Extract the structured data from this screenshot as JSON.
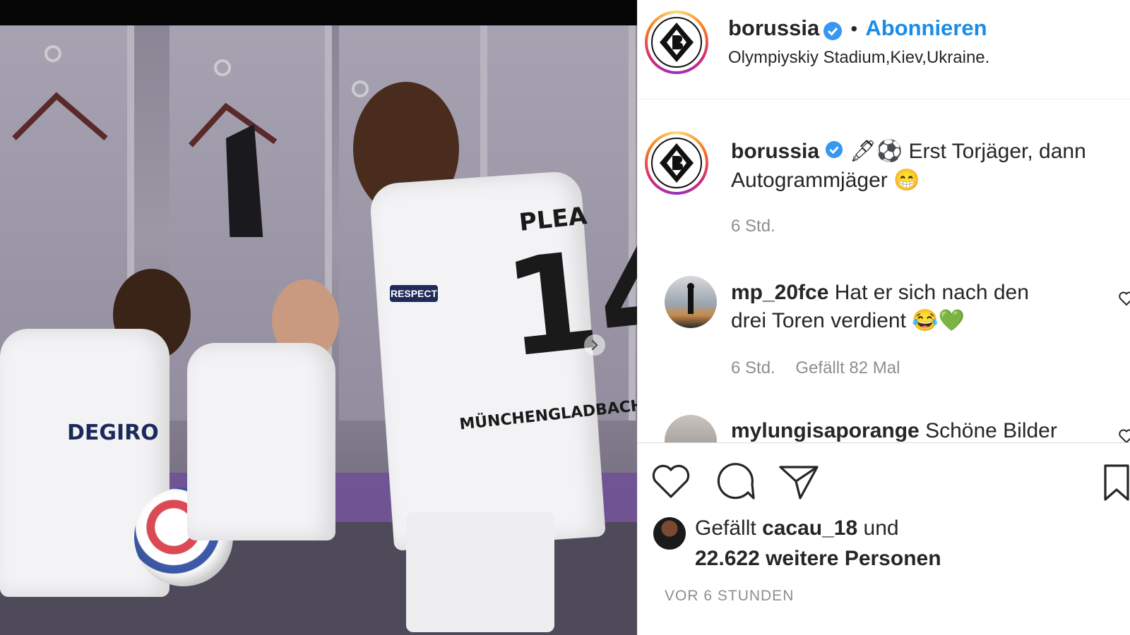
{
  "post": {
    "author": "borussia",
    "follow_label": "Abonnieren",
    "separator": "•",
    "location": "Olympiyskiy Stadium,Kiev,Ukraine.",
    "player_name": "PLEA",
    "player_number": "14",
    "shirt_text": "MÜNCHENGLADBACH",
    "sleeve_text": "RESPECT",
    "sponsor_text": "DEGIRO"
  },
  "caption": {
    "username": "borussia",
    "emojis": "🖋⚽",
    "text_line1": "Erst Torjäger, dann",
    "text_line2": "Autogrammjäger",
    "emoji_end": "😁",
    "time": "6 Std."
  },
  "comments": [
    {
      "username": "mp_20fce",
      "text_line1": "Hat er sich nach den",
      "text_line2": "drei Toren verdient",
      "emojis": "😂💚",
      "time": "6 Std.",
      "likes": "Gefällt 82 Mal"
    },
    {
      "username": "mylungisaporange",
      "text": "Schöne Bilder"
    }
  ],
  "likes": {
    "prefix": "Gefällt",
    "user": "cacau_18",
    "conj": "und",
    "count": "22.622 weitere Personen"
  },
  "timestamp": "VOR 6 STUNDEN",
  "icons": {
    "verified": "verified-badge-icon",
    "like": "heart-icon",
    "comment": "comment-bubble-icon",
    "share": "paper-plane-icon",
    "save": "bookmark-icon",
    "next": "chevron-right-icon"
  },
  "colors": {
    "follow": "#1a8ce6",
    "verified": "#3897f0",
    "meta_gray": "#8e8e8e"
  }
}
